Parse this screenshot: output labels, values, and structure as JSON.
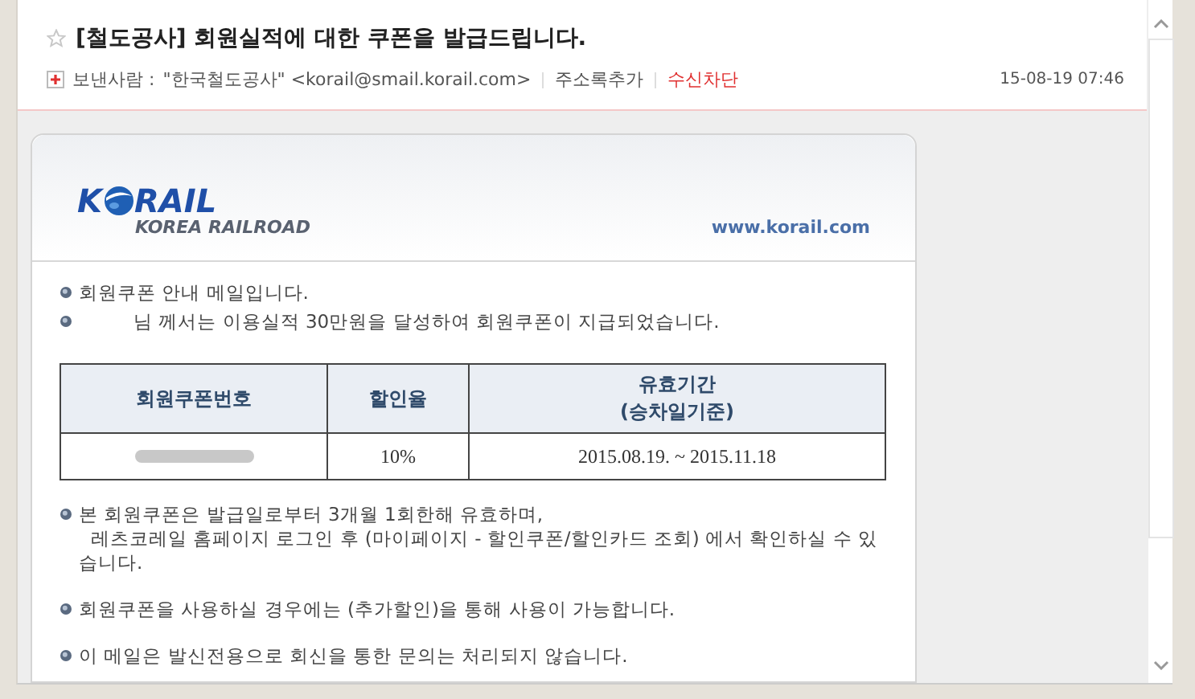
{
  "mail": {
    "starred": false,
    "subject": "[철도공사] 회원실적에 대한 쿠폰을 발급드립니다.",
    "sender_label": "보낸사람 :",
    "sender": "\"한국철도공사\" <korail@smail.korail.com>",
    "add_contact": "주소록추가",
    "block": "수신차단",
    "date": "15-08-19 07:46"
  },
  "banner": {
    "logo_parts": [
      "K",
      "RAIL"
    ],
    "logo_subtitle": "KOREA RAILROAD",
    "url": "www.korail.com"
  },
  "intro": [
    "회원쿠폰 안내 메일입니다.",
    "님 께서는 이용실적 30만원을 달성하여 회원쿠폰이 지급되었습니다."
  ],
  "table": {
    "columns": [
      "회원쿠폰번호",
      "할인율",
      "유효기간\n(승차일기준)"
    ],
    "rows": [
      {
        "cells": [
          "",
          "10%",
          "2015.08.19. ~ 2015.11.18"
        ],
        "redacted": true
      }
    ]
  },
  "notes": [
    "본 회원쿠폰은 발급일로부터 3개월 1회한해 유효하며,\n  레츠코레일 홈페이지 로그인 후 (마이페이지 - 할인쿠폰/할인카드 조회) 에서 확인하실 수 있습니다.",
    "회원쿠폰을 사용하실 경우에는 (추가할인)을 통해 사용이 가능합니다.",
    "이 메일은 발신전용으로 회신을 통한 문의는 처리되지 않습니다."
  ]
}
